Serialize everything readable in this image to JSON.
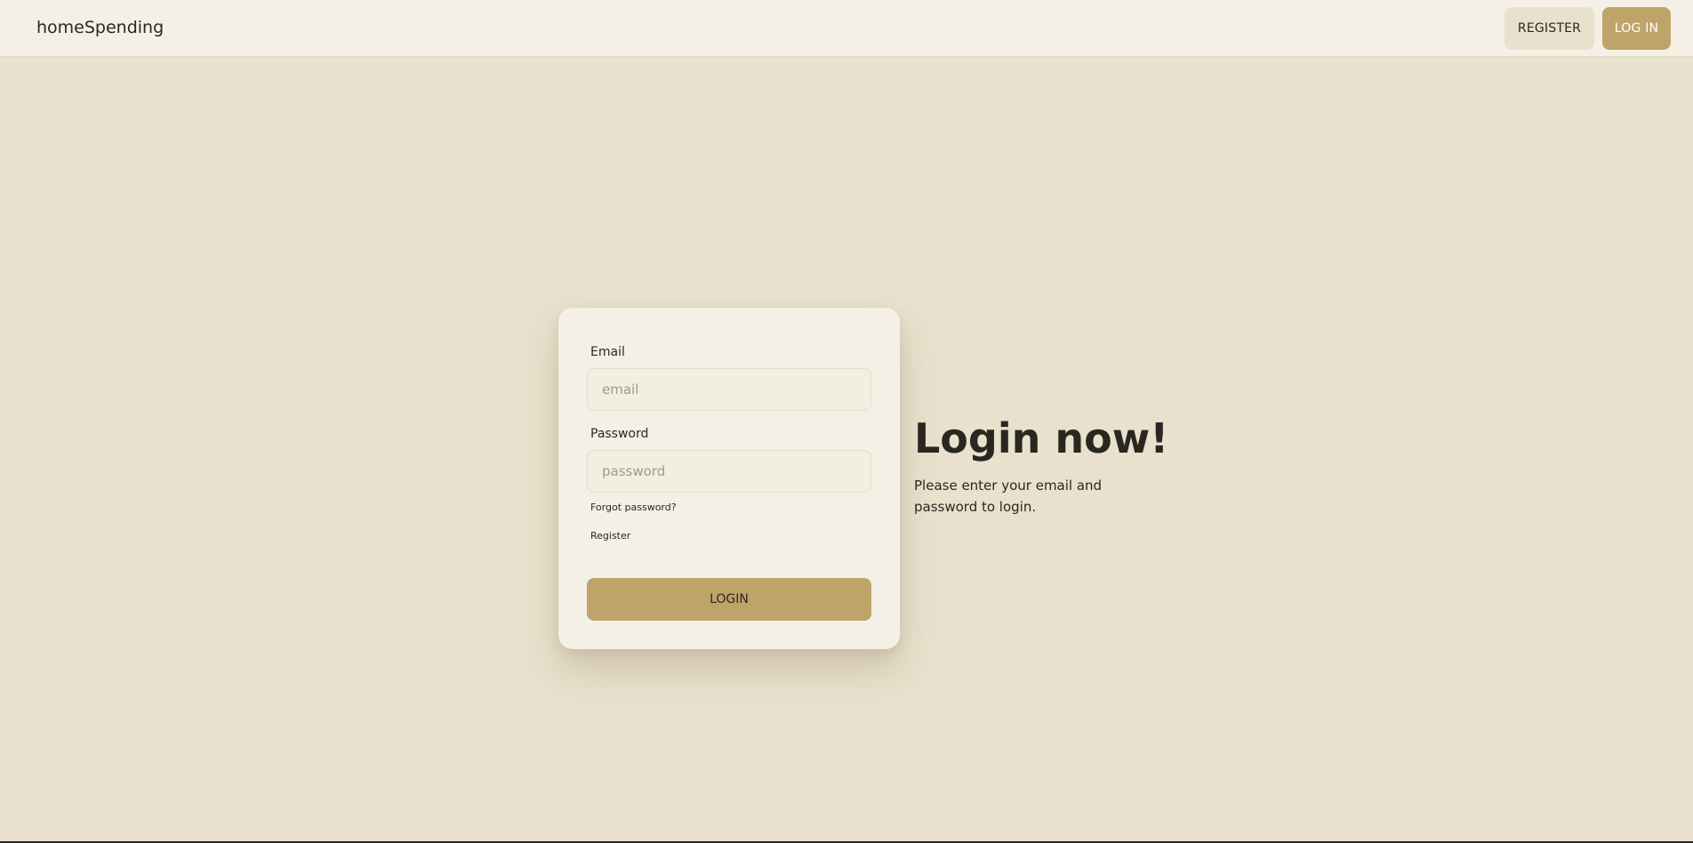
{
  "navbar": {
    "brand": "homeSpending",
    "register_label": "REGISTER",
    "login_label": "LOG IN"
  },
  "form": {
    "email_label": "Email",
    "email_placeholder": "email",
    "password_label": "Password",
    "password_placeholder": "password",
    "forgot_password": "Forgot password?",
    "register_link": "Register",
    "submit_label": "LOGIN"
  },
  "hero": {
    "title": "Login now!",
    "subtitle": "Please enter your email and password to login."
  },
  "colors": {
    "page_background": "#e9e1cd",
    "navbar_background": "#f5f0e5",
    "card_background": "#f5f0e5",
    "accent": "#bfa46a",
    "text": "#2a2721"
  }
}
